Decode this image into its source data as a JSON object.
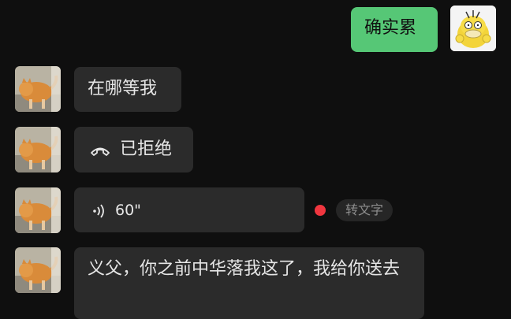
{
  "messages": {
    "self_1": {
      "text": "确实累"
    },
    "other_1": {
      "text": "在哪等我"
    },
    "other_2": {
      "text": "已拒绝",
      "icon": "phone-hangup-icon"
    },
    "other_3": {
      "duration": "60\"",
      "icon": "voice-waves-icon",
      "action": "转文字"
    },
    "other_4": {
      "text": "义父，你之前中华落我这了，我给你送去"
    }
  },
  "colors": {
    "background": "#0f0f0f",
    "bubble_other": "#2b2b2b",
    "bubble_self": "#56c776",
    "unread_dot": "#f0363f"
  }
}
